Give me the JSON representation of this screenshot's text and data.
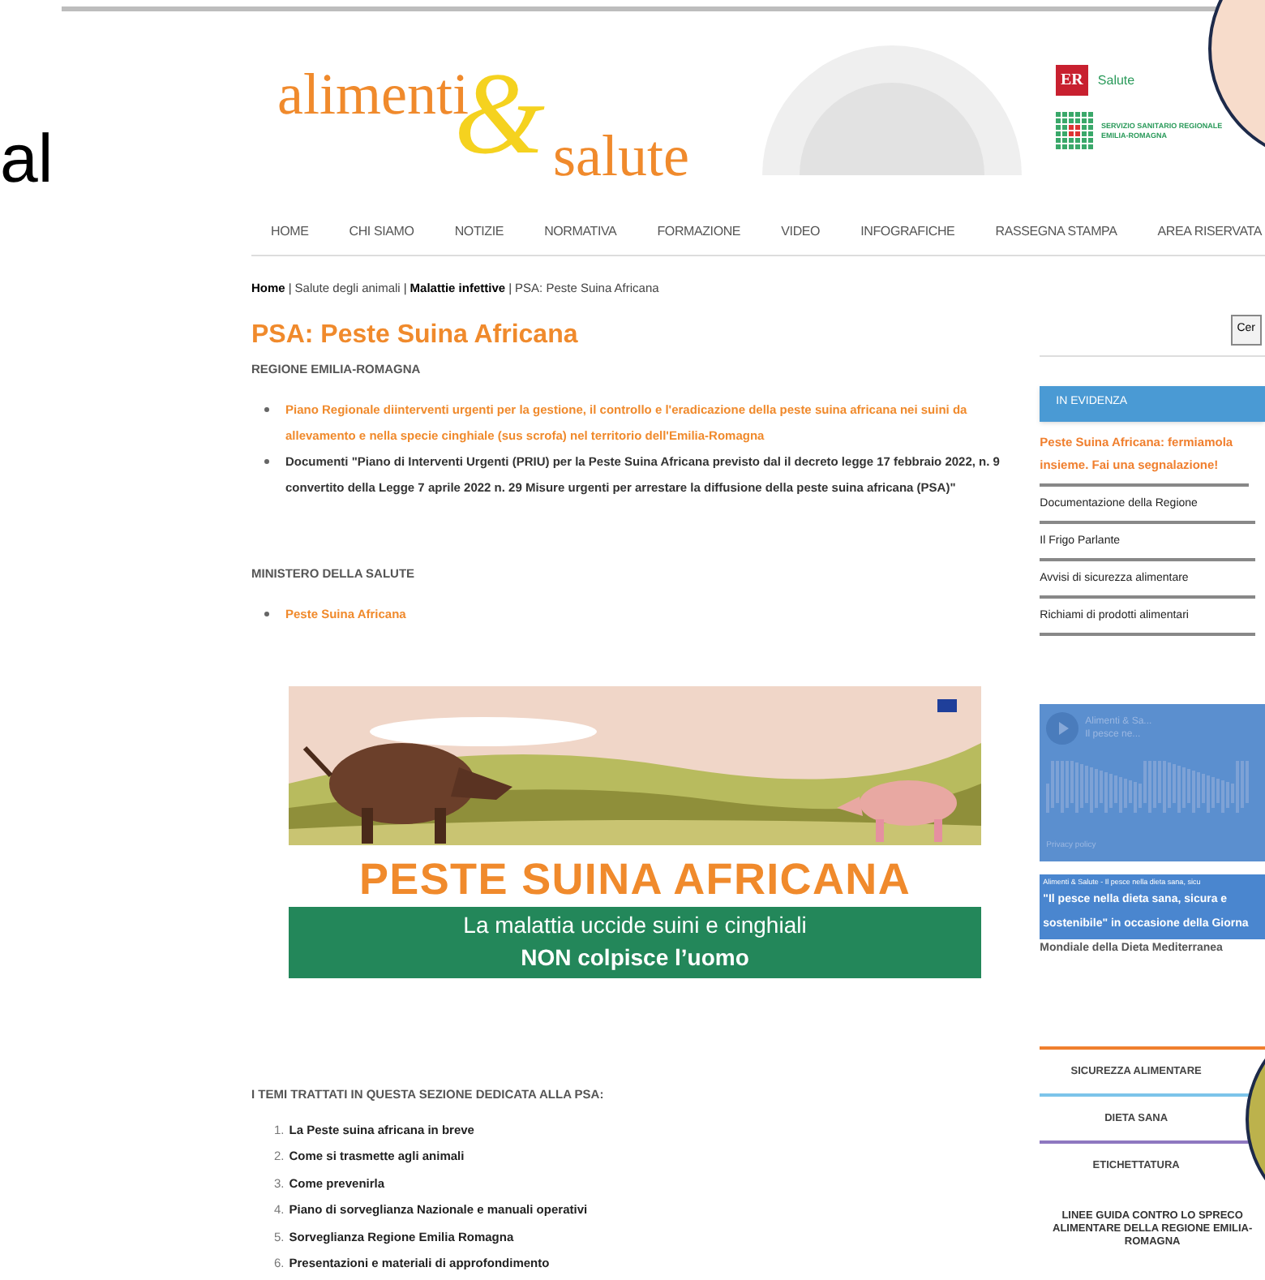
{
  "slide": {
    "text_fragment": "al"
  },
  "header": {
    "logo": {
      "word1": "alimenti",
      "ampersand": "&",
      "word2": "salute"
    },
    "er_logo": {
      "mark": "ER",
      "name": "Salute"
    },
    "ssr_logo": {
      "line1": "SERVIZIO SANITARIO REGIONALE",
      "line2": "EMILIA-ROMAGNA"
    }
  },
  "nav": [
    "HOME",
    "CHI SIAMO",
    "NOTIZIE",
    "NORMATIVA",
    "FORMAZIONE",
    "VIDEO",
    "INFOGRAFICHE",
    "RASSEGNA STAMPA",
    "AREA RISERVATA"
  ],
  "breadcrumb": {
    "separator": "|",
    "items": [
      {
        "label": "Home",
        "bold": true
      },
      {
        "label": "Salute degli animali",
        "bold": false
      },
      {
        "label": "Malattie infettive",
        "bold": true
      },
      {
        "label": "PSA: Peste Suina Africana",
        "bold": false
      }
    ]
  },
  "page_title": "PSA: Peste Suina Africana",
  "sections": [
    {
      "heading": "REGIONE EMILIA-ROMAGNA",
      "items": [
        {
          "text": "Piano Regionale diinterventi urgenti per la gestione, il controllo e l'eradicazione della peste suina africana nei suini da allevamento e nella specie cinghiale (sus scrofa) nel territorio dell'Emilia-Romagna",
          "link": true
        },
        {
          "text": "Documenti \"Piano di Interventi Urgenti (PRIU) per la Peste Suina Africana previsto dal il decreto legge 17 febbraio 2022, n. 9 convertito della Legge 7 aprile 2022 n. 29 Misure urgenti per arrestare la diffusione della peste suina africana (PSA)\"",
          "link": false
        }
      ]
    },
    {
      "heading": "MINISTERO DELLA SALUTE",
      "items": [
        {
          "text": "Peste Suina Africana",
          "link": true
        }
      ]
    }
  ],
  "banner": {
    "title": "PESTE SUINA AFRICANA",
    "line1": "La malattia uccide suini e cinghiali",
    "line2": "NON colpisce l’uomo"
  },
  "topics": {
    "heading": "I TEMI TRATTATI IN QUESTA SEZIONE DEDICATA ALLA PSA:",
    "items": [
      {
        "number": "1.",
        "text": "La Peste suina africana in breve"
      },
      {
        "number": "2.",
        "text": "Come si trasmette agli animali"
      },
      {
        "number": "3.",
        "text": "Come prevenirla"
      },
      {
        "number": "4.",
        "text": "Piano di sorveglianza Nazionale e manuali operativi"
      },
      {
        "number": "5.",
        "text": "Sorveglianza Regione Emilia Romagna"
      },
      {
        "number": "6.",
        "text": "Presentazioni e materiali di approfondimento"
      }
    ]
  },
  "sidebar": {
    "search_button": "Cer",
    "evidence_heading": "IN EVIDENZA",
    "highlight": "Peste Suina Africana: fermiamola insieme. Fai una segnalazione!",
    "links": [
      "Documentazione della Regione",
      "Il Frigo Parlante",
      "Avvisi di sicurezza alimentare",
      "Richiami di prodotti alimentari"
    ],
    "player": {
      "artist": "Alimenti & Sa...",
      "track": "Il pesce ne...",
      "privacy": "Privacy policy"
    },
    "caption": {
      "small": "Alimenti & Salute - Il pesce nella dieta sana, sicu",
      "highlighted": "\"Il pesce nella dieta sana, sicura e sostenibile\" in occasione della Giorna",
      "rest": "Mondiale della Dieta Mediterranea"
    },
    "categories": [
      {
        "label": "SICUREZZA ALIMENTARE",
        "color": "#f07f2e"
      },
      {
        "label": "DIETA SANA",
        "color": "#7cc4ea"
      },
      {
        "label": "ETICHETTATURA",
        "color": "#8e78c0"
      }
    ],
    "guidelines": "LINEE GUIDA CONTRO LO SPRECO ALIMENTARE DELLA REGIONE EMILIA-ROMAGNA"
  }
}
